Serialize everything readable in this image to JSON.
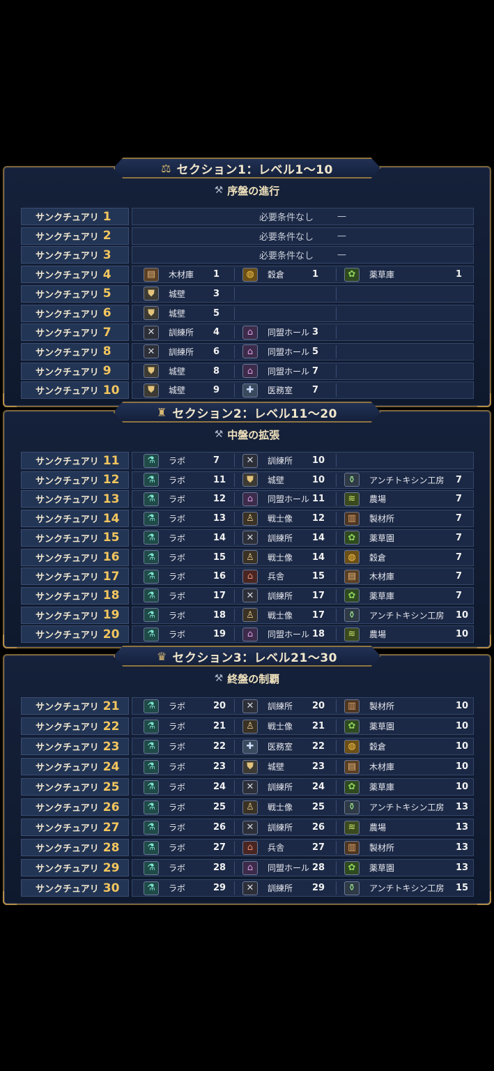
{
  "sections": [
    {
      "title": "セクション1：レベル1〜10",
      "banner_icon": "scale-icon",
      "subtitle": "序盤の進行",
      "subtitle_icon": "anvil-icon",
      "rows": [
        {
          "label": "サンクチュアリ",
          "level": "1",
          "none": "必要条件なし",
          "dash": "—",
          "reqs": []
        },
        {
          "label": "サンクチュアリ",
          "level": "2",
          "none": "必要条件なし",
          "dash": "—",
          "reqs": []
        },
        {
          "label": "サンクチュアリ",
          "level": "3",
          "none": "必要条件なし",
          "dash": "—",
          "reqs": []
        },
        {
          "label": "サンクチュアリ",
          "level": "4",
          "reqs": [
            {
              "icon": "wood",
              "name": "木材庫",
              "level": "1"
            },
            {
              "icon": "grain",
              "name": "穀倉",
              "level": "1"
            },
            {
              "icon": "herb",
              "name": "薬草庫",
              "level": "1"
            }
          ]
        },
        {
          "label": "サンクチュアリ",
          "level": "5",
          "reqs": [
            {
              "icon": "wall",
              "name": "城壁",
              "level": "3"
            }
          ]
        },
        {
          "label": "サンクチュアリ",
          "level": "6",
          "reqs": [
            {
              "icon": "wall",
              "name": "城壁",
              "level": "5"
            }
          ]
        },
        {
          "label": "サンクチュアリ",
          "level": "7",
          "reqs": [
            {
              "icon": "train",
              "name": "訓練所",
              "level": "4"
            },
            {
              "icon": "hall",
              "name": "同盟ホール",
              "level": "3"
            }
          ]
        },
        {
          "label": "サンクチュアリ",
          "level": "8",
          "reqs": [
            {
              "icon": "train",
              "name": "訓練所",
              "level": "6"
            },
            {
              "icon": "hall",
              "name": "同盟ホール",
              "level": "5"
            }
          ]
        },
        {
          "label": "サンクチュアリ",
          "level": "9",
          "reqs": [
            {
              "icon": "wall",
              "name": "城壁",
              "level": "8"
            },
            {
              "icon": "hall",
              "name": "同盟ホール",
              "level": "7"
            }
          ]
        },
        {
          "label": "サンクチュアリ",
          "level": "10",
          "reqs": [
            {
              "icon": "wall",
              "name": "城壁",
              "level": "9"
            },
            {
              "icon": "med",
              "name": "医務室",
              "level": "7"
            }
          ]
        }
      ]
    },
    {
      "title": "セクション2：レベル11〜20",
      "banner_icon": "castle-icon",
      "subtitle": "中盤の拡張",
      "subtitle_icon": "anvil-icon",
      "rows": [
        {
          "label": "サンクチュアリ",
          "level": "11",
          "reqs": [
            {
              "icon": "lab",
              "name": "ラボ",
              "level": "7"
            },
            {
              "icon": "train",
              "name": "訓練所",
              "level": "10"
            }
          ]
        },
        {
          "label": "サンクチュアリ",
          "level": "12",
          "reqs": [
            {
              "icon": "lab",
              "name": "ラボ",
              "level": "11"
            },
            {
              "icon": "wall",
              "name": "城壁",
              "level": "10"
            },
            {
              "icon": "anti",
              "name": "アンチトキシン工房",
              "level": "7"
            }
          ]
        },
        {
          "label": "サンクチュアリ",
          "level": "13",
          "reqs": [
            {
              "icon": "lab",
              "name": "ラボ",
              "level": "12"
            },
            {
              "icon": "hall",
              "name": "同盟ホール",
              "level": "11"
            },
            {
              "icon": "farm",
              "name": "農場",
              "level": "7"
            }
          ]
        },
        {
          "label": "サンクチュアリ",
          "level": "14",
          "reqs": [
            {
              "icon": "lab",
              "name": "ラボ",
              "level": "13"
            },
            {
              "icon": "statue",
              "name": "戦士像",
              "level": "12"
            },
            {
              "icon": "mill",
              "name": "製材所",
              "level": "7"
            }
          ]
        },
        {
          "label": "サンクチュアリ",
          "level": "15",
          "reqs": [
            {
              "icon": "lab",
              "name": "ラボ",
              "level": "14"
            },
            {
              "icon": "train",
              "name": "訓練所",
              "level": "14"
            },
            {
              "icon": "herb",
              "name": "薬草園",
              "level": "7"
            }
          ]
        },
        {
          "label": "サンクチュアリ",
          "level": "16",
          "reqs": [
            {
              "icon": "lab",
              "name": "ラボ",
              "level": "15"
            },
            {
              "icon": "statue",
              "name": "戦士像",
              "level": "14"
            },
            {
              "icon": "grain",
              "name": "穀倉",
              "level": "7"
            }
          ]
        },
        {
          "label": "サンクチュアリ",
          "level": "17",
          "reqs": [
            {
              "icon": "lab",
              "name": "ラボ",
              "level": "16"
            },
            {
              "icon": "barracks",
              "name": "兵舎",
              "level": "15"
            },
            {
              "icon": "wood",
              "name": "木材庫",
              "level": "7"
            }
          ]
        },
        {
          "label": "サンクチュアリ",
          "level": "18",
          "reqs": [
            {
              "icon": "lab",
              "name": "ラボ",
              "level": "17"
            },
            {
              "icon": "train",
              "name": "訓練所",
              "level": "17"
            },
            {
              "icon": "herb",
              "name": "薬草庫",
              "level": "7"
            }
          ]
        },
        {
          "label": "サンクチュアリ",
          "level": "19",
          "reqs": [
            {
              "icon": "lab",
              "name": "ラボ",
              "level": "18"
            },
            {
              "icon": "statue",
              "name": "戦士像",
              "level": "17"
            },
            {
              "icon": "anti",
              "name": "アンチトキシン工房",
              "level": "10"
            }
          ]
        },
        {
          "label": "サンクチュアリ",
          "level": "20",
          "reqs": [
            {
              "icon": "lab",
              "name": "ラボ",
              "level": "19"
            },
            {
              "icon": "hall",
              "name": "同盟ホール",
              "level": "18"
            },
            {
              "icon": "farm",
              "name": "農場",
              "level": "10"
            }
          ]
        }
      ]
    },
    {
      "title": "セクション3：レベル21〜30",
      "banner_icon": "throne-icon",
      "subtitle": "終盤の制覇",
      "subtitle_icon": "anvil-icon",
      "rows": [
        {
          "label": "サンクチュアリ",
          "level": "21",
          "reqs": [
            {
              "icon": "lab",
              "name": "ラボ",
              "level": "20"
            },
            {
              "icon": "train",
              "name": "訓練所",
              "level": "20"
            },
            {
              "icon": "mill",
              "name": "製材所",
              "level": "10"
            }
          ]
        },
        {
          "label": "サンクチュアリ",
          "level": "22",
          "reqs": [
            {
              "icon": "lab",
              "name": "ラボ",
              "level": "21"
            },
            {
              "icon": "statue",
              "name": "戦士像",
              "level": "21"
            },
            {
              "icon": "herb",
              "name": "薬草園",
              "level": "10"
            }
          ]
        },
        {
          "label": "サンクチュアリ",
          "level": "23",
          "reqs": [
            {
              "icon": "lab",
              "name": "ラボ",
              "level": "22"
            },
            {
              "icon": "med",
              "name": "医務室",
              "level": "22"
            },
            {
              "icon": "grain",
              "name": "穀倉",
              "level": "10"
            }
          ]
        },
        {
          "label": "サンクチュアリ",
          "level": "24",
          "reqs": [
            {
              "icon": "lab",
              "name": "ラボ",
              "level": "23"
            },
            {
              "icon": "wall",
              "name": "城壁",
              "level": "23"
            },
            {
              "icon": "wood",
              "name": "木材庫",
              "level": "10"
            }
          ]
        },
        {
          "label": "サンクチュアリ",
          "level": "25",
          "reqs": [
            {
              "icon": "lab",
              "name": "ラボ",
              "level": "24"
            },
            {
              "icon": "train",
              "name": "訓練所",
              "level": "24"
            },
            {
              "icon": "herb",
              "name": "薬草庫",
              "level": "10"
            }
          ]
        },
        {
          "label": "サンクチュアリ",
          "level": "26",
          "reqs": [
            {
              "icon": "lab",
              "name": "ラボ",
              "level": "25"
            },
            {
              "icon": "statue",
              "name": "戦士像",
              "level": "25"
            },
            {
              "icon": "anti",
              "name": "アンチトキシン工房",
              "level": "13"
            }
          ]
        },
        {
          "label": "サンクチュアリ",
          "level": "27",
          "reqs": [
            {
              "icon": "lab",
              "name": "ラボ",
              "level": "26"
            },
            {
              "icon": "train",
              "name": "訓練所",
              "level": "26"
            },
            {
              "icon": "farm",
              "name": "農場",
              "level": "13"
            }
          ]
        },
        {
          "label": "サンクチュアリ",
          "level": "28",
          "reqs": [
            {
              "icon": "lab",
              "name": "ラボ",
              "level": "27"
            },
            {
              "icon": "barracks",
              "name": "兵舎",
              "level": "27"
            },
            {
              "icon": "mill",
              "name": "製材所",
              "level": "13"
            }
          ]
        },
        {
          "label": "サンクチュアリ",
          "level": "29",
          "reqs": [
            {
              "icon": "lab",
              "name": "ラボ",
              "level": "28"
            },
            {
              "icon": "hall",
              "name": "同盟ホール",
              "level": "28"
            },
            {
              "icon": "herb",
              "name": "薬草園",
              "level": "13"
            }
          ]
        },
        {
          "label": "サンクチュアリ",
          "level": "30",
          "reqs": [
            {
              "icon": "lab",
              "name": "ラボ",
              "level": "29"
            },
            {
              "icon": "train",
              "name": "訓練所",
              "level": "29"
            },
            {
              "icon": "anti",
              "name": "アンチトキシン工房",
              "level": "15"
            }
          ]
        }
      ]
    }
  ],
  "icon_glyphs": {
    "wood": "▤",
    "grain": "◍",
    "herb": "✿",
    "wall": "⛊",
    "train": "✕",
    "hall": "⌂",
    "med": "✚",
    "lab": "⚗",
    "anti": "⚱",
    "farm": "≋",
    "mill": "▥",
    "statue": "♙",
    "barracks": "⌂",
    "scale-icon": "⚖",
    "castle-icon": "♜",
    "throne-icon": "♛",
    "anvil-icon": "⚒"
  }
}
